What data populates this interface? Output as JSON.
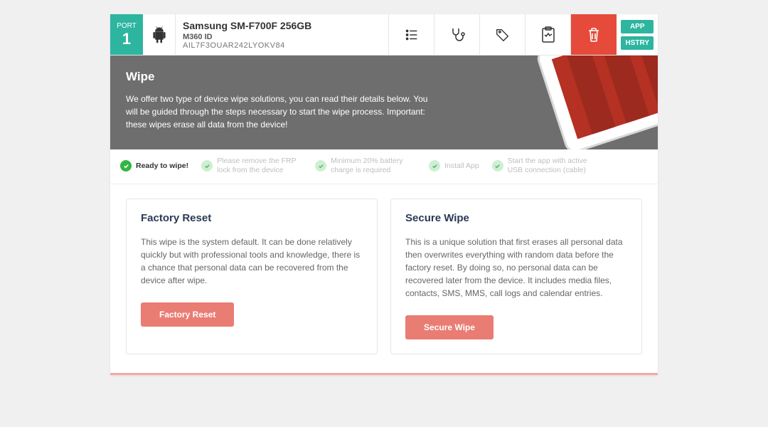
{
  "header": {
    "port_label": "PORT",
    "port_number": "1",
    "device_name": "Samsung SM-F700F 256GB",
    "m360_label": "M360 ID",
    "m360_value": "AIL7F3OUAR242LYOKV84",
    "side_buttons": {
      "app": "APP",
      "hstry": "HSTRY"
    }
  },
  "hero": {
    "title": "Wipe",
    "text": "We offer two type of device wipe solutions, you can read their details below. You will be guided through the steps necessary to start the wipe process. Important: these wipes erase all data from the device!"
  },
  "status": [
    {
      "label": "Ready to wipe!",
      "active": true
    },
    {
      "label": "Please remove the FRP lock from the device",
      "active": false
    },
    {
      "label": "Minimum 20% battery charge is required",
      "active": false
    },
    {
      "label": "Install App",
      "active": false
    },
    {
      "label": "Start the app with active USB connection (cable)",
      "active": false
    }
  ],
  "cards": {
    "factory": {
      "title": "Factory Reset",
      "desc": "This wipe is the system default. It can be done relatively quickly but with professional tools and knowledge, there is a chance that personal data can be recovered from the device after wipe.",
      "button": "Factory Reset"
    },
    "secure": {
      "title": "Secure Wipe",
      "desc": "This is a unique solution that first erases all personal data then overwrites everything with random data before the factory reset. By doing so, no personal data can be recovered later from the device. It includes media files, contacts, SMS, MMS, call logs and calendar entries.",
      "button": "Secure Wipe"
    }
  }
}
